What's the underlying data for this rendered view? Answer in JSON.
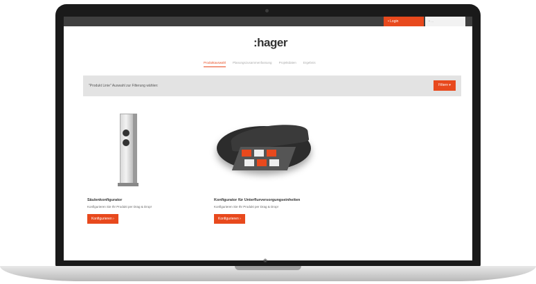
{
  "topbar": {
    "login_label": "• Login",
    "cart_label": "• ..."
  },
  "brand": {
    "logo_text": ":hager",
    "accent_color": "#e8491d"
  },
  "nav": {
    "items": [
      {
        "label": "Produktauswahl",
        "active": true
      },
      {
        "label": "Planungszusammenfassung",
        "active": false
      },
      {
        "label": "Projektdaten",
        "active": false
      },
      {
        "label": "Ergebnis",
        "active": false
      }
    ]
  },
  "filter": {
    "label": "\"Produkt Linie\" Auswahl zur Filterung wählen:",
    "button_label": "Filtern ▾"
  },
  "products": [
    {
      "title": "Säulenkonfigurator",
      "description": "Konfigurieren Sie Ihr Produkt per Drag & Drop!",
      "button_label": "Konfigurieren ›",
      "image_icon": "pillar-outlet-icon"
    },
    {
      "title": "Konfigurator für Unterflurversorgungseinheiten",
      "description": "Konfigurieren Sie Ihr Produkt per Drag & Drop!",
      "button_label": "Konfigurieren ›",
      "image_icon": "floor-box-icon"
    }
  ],
  "laptop": {
    "bezel_label": "◉"
  }
}
